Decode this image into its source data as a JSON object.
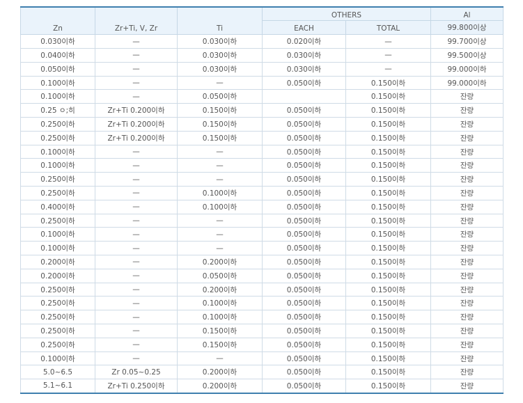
{
  "headers": {
    "zn": "Zn",
    "zr": "Zr+Ti, V, Zr",
    "ti": "Ti",
    "others": "OTHERS",
    "each": "EACH",
    "total": "TOTAL",
    "al": "Al",
    "al_sub": "99.800이상"
  },
  "rows": [
    [
      "0.030이하",
      "—",
      "0.030이하",
      "0.020이하",
      "—",
      "99.700이상"
    ],
    [
      "0.040이하",
      "—",
      "0.030이하",
      "0.030이하",
      "—",
      "99.500이상"
    ],
    [
      "0.050이하",
      "—",
      "0.030이하",
      "0.030이하",
      "—",
      "99.000이하"
    ],
    [
      "0.100이하",
      "—",
      "—",
      "0.050이하",
      "0.150이하",
      "99.000이하"
    ],
    [
      "0.100이하",
      "—",
      "0.050이하",
      "",
      "0.150이하",
      "잔량"
    ],
    [
      "0.25 ㅇ;히",
      "Zr+Ti 0.200이하",
      "0.150이하",
      "0.050이하",
      "0.150이하",
      "잔량"
    ],
    [
      "0.250이하",
      "Zr+Ti 0.200이하",
      "0.150이하",
      "0.050이하",
      "0.150이하",
      "잔량"
    ],
    [
      "0.250이하",
      "Zr+Ti 0.200이하",
      "0.150이하",
      "0.050이하",
      "0.150이하",
      "잔량"
    ],
    [
      "0.100이하",
      "—",
      "—",
      "0.050이하",
      "0.150이하",
      "잔량"
    ],
    [
      "0.100이하",
      "—",
      "—",
      "0.050이하",
      "0.150이하",
      "잔량"
    ],
    [
      "0.250이하",
      "—",
      "—",
      "0.050이하",
      "0.150이하",
      "잔량"
    ],
    [
      "0.250이하",
      "—",
      "0.100이하",
      "0.050이하",
      "0.150이하",
      "잔량"
    ],
    [
      "0.400이하",
      "—",
      "0.100이하",
      "0.050이하",
      "0.150이하",
      "잔량"
    ],
    [
      "0.250이하",
      "—",
      "—",
      "0.050이하",
      "0.150이하",
      "잔량"
    ],
    [
      "0.100이하",
      "—",
      "—",
      "0.050이하",
      "0.150이하",
      "잔량"
    ],
    [
      "0.100이하",
      "—",
      "—",
      "0.050이하",
      "0.150이하",
      "잔량"
    ],
    [
      "0.200이하",
      "—",
      "0.200이하",
      "0.050이하",
      "0.150이하",
      "잔량"
    ],
    [
      "0.200이하",
      "—",
      "0.050이하",
      "0.050이하",
      "0.150이하",
      "잔량"
    ],
    [
      "0.250이하",
      "—",
      "0.200이하",
      "0.050이하",
      "0.150이하",
      "잔량"
    ],
    [
      "0.250이하",
      "—",
      "0.100이하",
      "0.050이하",
      "0.150이하",
      "잔량"
    ],
    [
      "0.250이하",
      "—",
      "0.100이하",
      "0.050이하",
      "0.150이하",
      "잔량"
    ],
    [
      "0.250이하",
      "—",
      "0.150이하",
      "0.050이하",
      "0.150이하",
      "잔량"
    ],
    [
      "0.250이하",
      "—",
      "0.150이하",
      "0.050이하",
      "0.150이하",
      "잔량"
    ],
    [
      "0.100이하",
      "—",
      "—",
      "0.050이하",
      "0.150이하",
      "잔량"
    ],
    [
      "5.0~6.5",
      "Zr 0.05~0.25",
      "0.200이하",
      "0.050이하",
      "0.150이하",
      "잔량"
    ],
    [
      "5.1~6.1",
      "Zr+Ti 0.250이하",
      "0.200이하",
      "0.050이하",
      "0.150이하",
      "잔량"
    ]
  ],
  "colors": {
    "border_accent": "#3f7fae",
    "header_bg": "#eaf3fb",
    "grid": "#cfdbe6",
    "text": "#555555"
  }
}
